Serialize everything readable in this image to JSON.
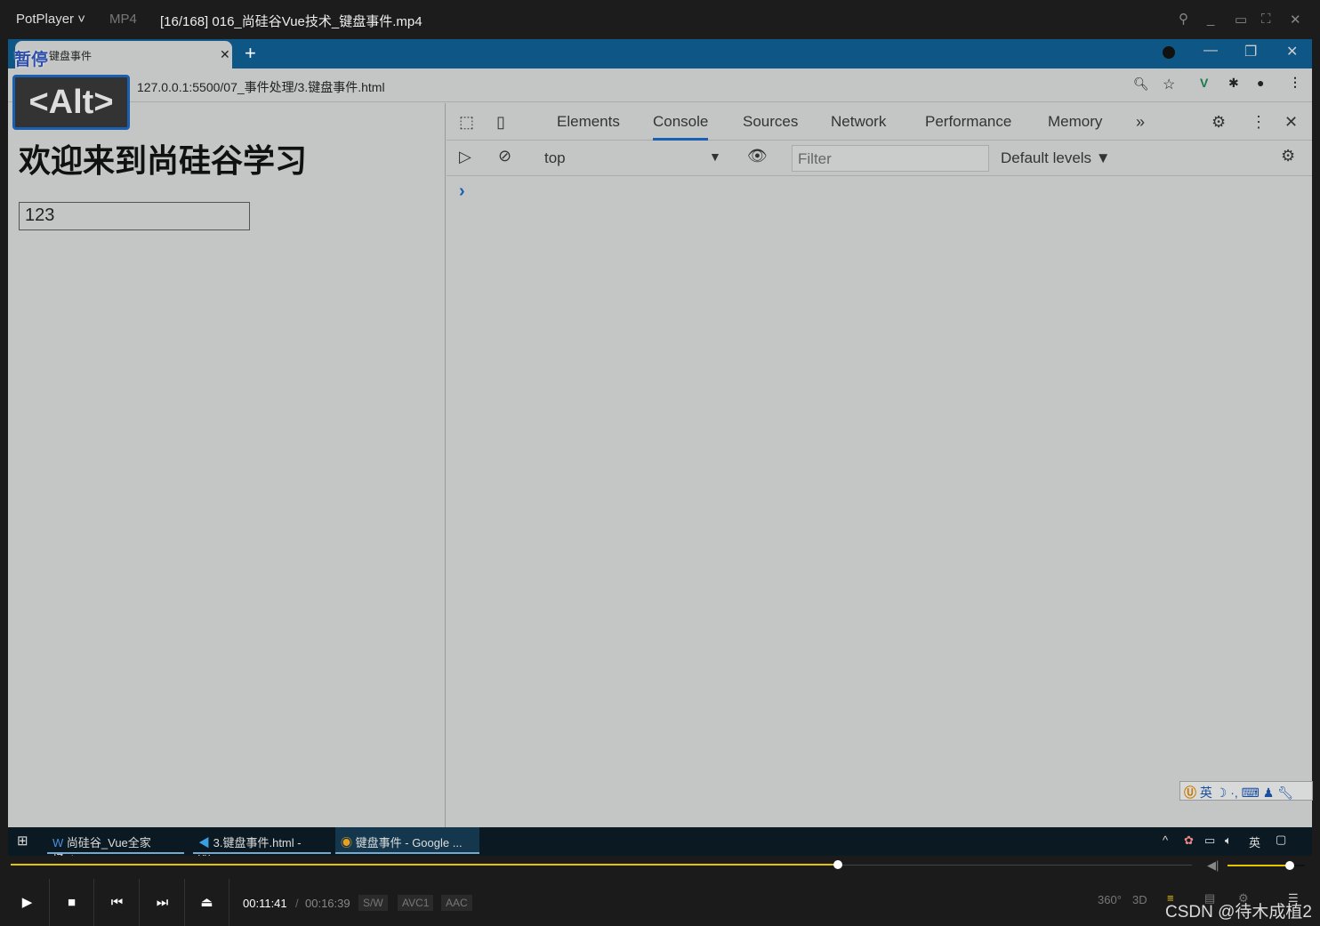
{
  "player": {
    "app": "PotPlayer",
    "format": "MP4",
    "title": "[16/168] 016_尚硅谷Vue技术_键盘事件.mp4",
    "pause_overlay": "暂停",
    "key_overlay": "<Alt>",
    "time_current": "00:11:41",
    "time_total": "00:16:39",
    "tags": [
      "S/W",
      "AVC1",
      "AAC"
    ],
    "progress_fraction": 0.7,
    "volume_fraction": 0.8,
    "watermark": "CSDN @待木成植2",
    "right_icons": [
      "360°",
      "3D"
    ]
  },
  "browser": {
    "tab_title": "键盘事件",
    "url": "127.0.0.1:5500/07_事件处理/3.键盘事件.html"
  },
  "page": {
    "heading": "欢迎来到尚硅谷学习",
    "input_value": "123"
  },
  "devtools": {
    "tabs": [
      "Elements",
      "Console",
      "Sources",
      "Network",
      "Performance",
      "Memory"
    ],
    "active_tab": "Console",
    "context": "top",
    "filter_placeholder": "Filter",
    "levels": "Default levels ▼",
    "prompt": "›"
  },
  "taskbar": {
    "items": [
      "尚硅谷_Vue全家桶.d...",
      "3.键盘事件.html - vu...",
      "键盘事件 - Google ..."
    ],
    "ime": "英"
  },
  "ime_bar": {
    "lang": "英"
  }
}
